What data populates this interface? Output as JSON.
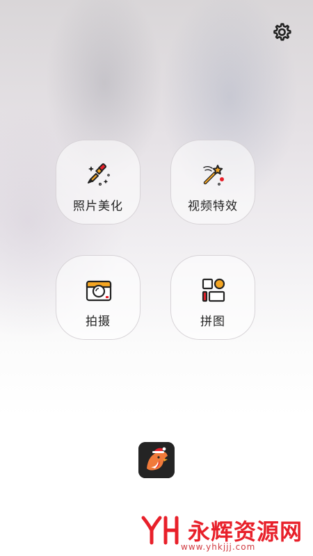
{
  "settings": {
    "icon": "gear-icon"
  },
  "tiles": [
    {
      "label": "照片美化",
      "icon": "magic-brush-icon"
    },
    {
      "label": "视频特效",
      "icon": "magic-wand-icon"
    },
    {
      "label": "拍摄",
      "icon": "camera-icon"
    },
    {
      "label": "拼图",
      "icon": "collage-icon"
    }
  ],
  "app_icon": {
    "icon": "santa-bird-app-icon"
  },
  "watermark": {
    "logo": "YH",
    "text": "永辉资源网",
    "url": "www.yhkjjj.com"
  },
  "colors": {
    "accent_orange": "#f5a623",
    "accent_red": "#e8202a",
    "tile_border": "#d7d3d7"
  }
}
